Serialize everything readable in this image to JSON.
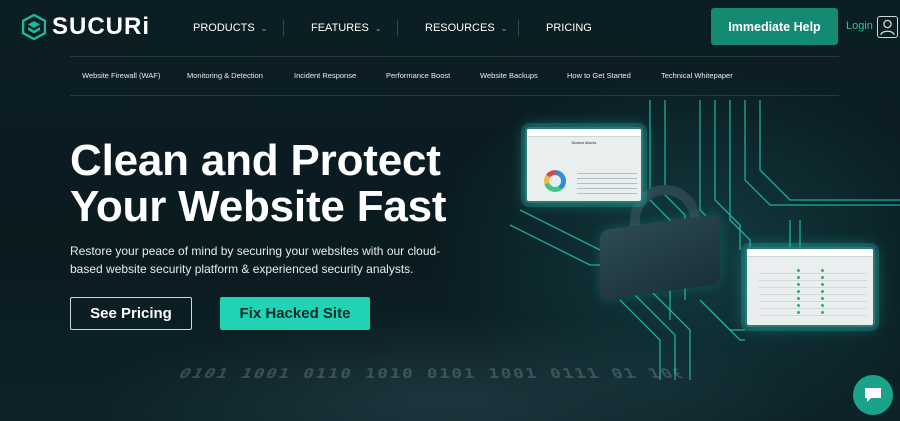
{
  "brand": {
    "name": "SUCURi",
    "accent": "#158a72",
    "highlight": "#1fd3b4"
  },
  "nav": {
    "items": [
      {
        "label": "PRODUCTS",
        "has_dropdown": true
      },
      {
        "label": "FEATURES",
        "has_dropdown": true
      },
      {
        "label": "RESOURCES",
        "has_dropdown": true
      },
      {
        "label": "PRICING",
        "has_dropdown": false
      }
    ],
    "help_button": "Immediate Help",
    "login": "Login"
  },
  "subnav": {
    "items": [
      "Website Firewall (WAF)",
      "Monitoring & Detection",
      "Incident Response",
      "Performance Boost",
      "Website Backups",
      "How to Get Started",
      "Technical Whitepaper"
    ]
  },
  "hero": {
    "headline": "Clean and Protect Your Website Fast",
    "subtext": "Restore your peace of mind by securing your websites with our cloud-based website security platform & experienced security analysts.",
    "primary_button": "See Pricing",
    "secondary_button": "Fix Hacked Site"
  },
  "illustration": {
    "screen1_title": "Blocked Attacks",
    "binary_text": "0101 1001 0110 1010 0101 1001 0111 01 1001 0101 1010 0101 0011 1001 0101 10"
  },
  "chat": {
    "icon": "chat-bubble-icon"
  }
}
